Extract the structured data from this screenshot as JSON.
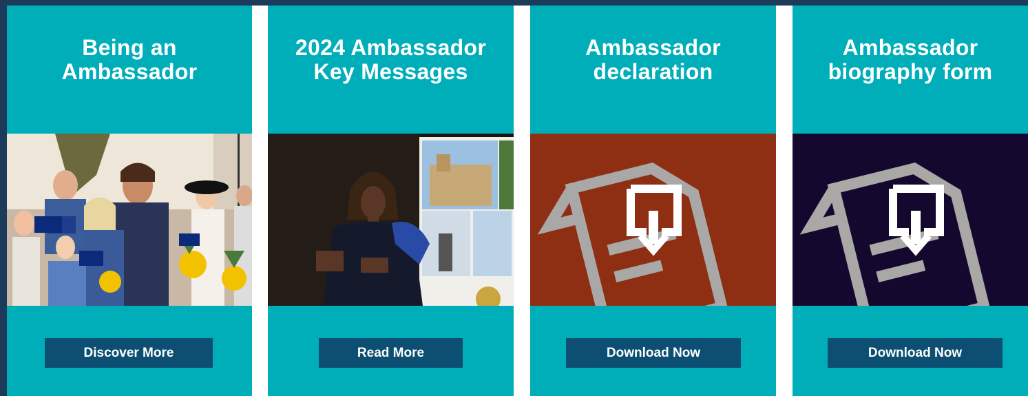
{
  "cards": [
    {
      "title_lines": [
        "Being an",
        "Ambassador"
      ],
      "image": "photo-citizenship-ceremony-group",
      "button_label": "Discover More"
    },
    {
      "title_lines": [
        "2024 Ambassador",
        "Key Messages"
      ],
      "image": "photo-speaker-on-stage",
      "button_label": "Read More"
    },
    {
      "title_lines": [
        "Ambassador",
        "declaration"
      ],
      "image": "document-download-icon",
      "image_bg": "#8e2e12",
      "button_label": "Download Now"
    },
    {
      "title_lines": [
        "Ambassador",
        "biography form"
      ],
      "image": "document-download-icon",
      "image_bg": "#15082e",
      "button_label": "Download Now"
    }
  ],
  "colors": {
    "card_bg": "#00aeb9",
    "button_bg": "#0c4f72",
    "frame": "#1c3a5a"
  }
}
